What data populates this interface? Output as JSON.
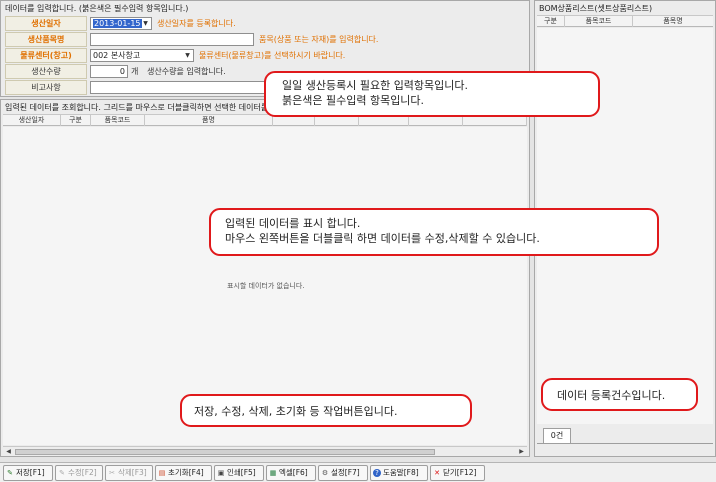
{
  "input_section": {
    "title": "데이터를 입력합니다. (붉은색은 필수입력 항목입니다.)",
    "fields": [
      {
        "label": "생산일자",
        "value": "2013-01-15",
        "hint": "생산일자를 등록합니다."
      },
      {
        "label": "생산품목명",
        "value": "",
        "hint": "품목(상품 또는 자재)를 입력합니다."
      },
      {
        "label": "물류센터(창고)",
        "value": "002 본사창고",
        "hint": "물류센터(물류창고)를 선택하시기 바랍니다."
      },
      {
        "label": "생산수량",
        "value": "0",
        "unit": "개",
        "hint": "생산수량을 입력합니다."
      },
      {
        "label": "비고사항",
        "value": ""
      }
    ]
  },
  "data_grid": {
    "title": "입력된 데이터를 조회합니다. 그리드를 마우스로 더블클릭하면 선택한 데이터를",
    "columns": [
      "생산일자",
      "구분",
      "품목코드",
      "품명",
      "",
      "",
      "",
      "",
      ""
    ],
    "empty_message": "표시할 데이터가 없습니다."
  },
  "bom_panel": {
    "title": "BOM상품리스트(셋트상품리스트)",
    "columns": [
      "구분",
      "품목코드",
      "품목명"
    ],
    "count_tab": "0건"
  },
  "callouts": {
    "input": [
      "일일 생산등록시 필요한 입력항목입니다.",
      "붉은색은 필수입력 항목입니다."
    ],
    "grid": [
      "입력된 데이터를 표시 합니다.",
      "마우스 왼쪽버튼을 더블클릭 하면 데이터를 수정,삭제할 수 있습니다."
    ],
    "toolbar": [
      "저장, 수정, 삭제, 초기화  등 작업버튼입니다."
    ],
    "count": [
      "데이터 등록건수입니다."
    ]
  },
  "toolbar": {
    "buttons": [
      {
        "label": "저장[F1]",
        "icon": "save-icon",
        "enabled": true
      },
      {
        "label": "수정[F2]",
        "icon": "edit-icon",
        "enabled": false
      },
      {
        "label": "삭제[F3]",
        "icon": "delete-icon",
        "enabled": false
      },
      {
        "label": "초기화[F4]",
        "icon": "reset-icon",
        "enabled": true
      },
      {
        "label": "인쇄[F5]",
        "icon": "print-icon",
        "enabled": true
      },
      {
        "label": "엑셀[F6]",
        "icon": "excel-icon",
        "enabled": true
      },
      {
        "label": "설정[F7]",
        "icon": "settings-icon",
        "enabled": true
      },
      {
        "label": "도움말[F8]",
        "icon": "help-icon",
        "enabled": true
      },
      {
        "label": "닫기[F12]",
        "icon": "close-icon",
        "enabled": true
      }
    ]
  },
  "colors": {
    "required_label": "#e07000",
    "callout_border": "#e0191b",
    "selected_date_bg": "#3366cc"
  }
}
